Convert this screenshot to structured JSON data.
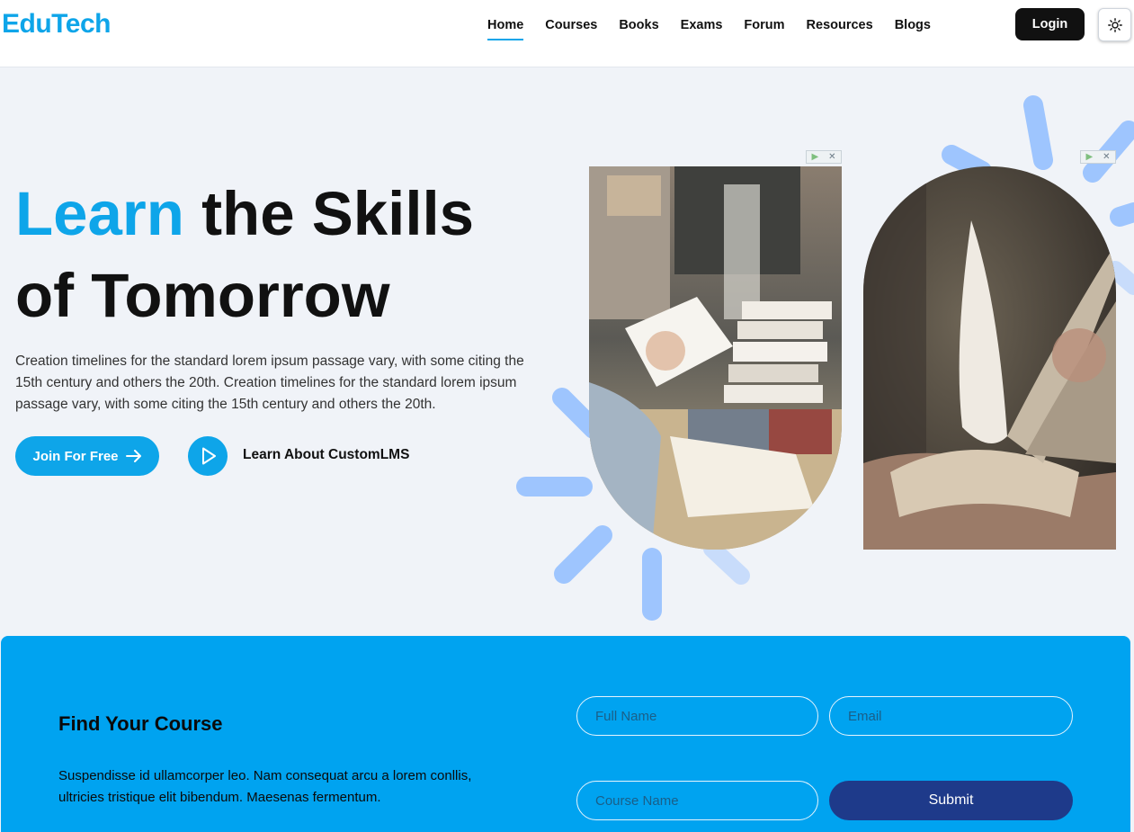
{
  "header": {
    "logo": "EduTech",
    "nav": [
      {
        "label": "Home",
        "active": true
      },
      {
        "label": "Courses",
        "active": false
      },
      {
        "label": "Books",
        "active": false
      },
      {
        "label": "Exams",
        "active": false
      },
      {
        "label": "Forum",
        "active": false
      },
      {
        "label": "Resources",
        "active": false
      },
      {
        "label": "Blogs",
        "active": false
      }
    ],
    "login_label": "Login",
    "theme_icon": "sun-icon"
  },
  "hero": {
    "title_accent": "Learn",
    "title_rest_line1": " the Skills",
    "title_line2": "of Tomorrow",
    "description": "Creation timelines for the standard lorem ipsum passage vary, with some citing the 15th century and others the 20th. Creation timelines for the standard lorem ipsum passage vary, with some citing the 15th century and others the 20th.",
    "join_label": "Join For Free",
    "learn_label": "Learn About CustomLMS"
  },
  "find": {
    "title": "Find Your Course",
    "description": "Suspendisse id ullamcorper leo. Nam consequat arcu a lorem conllis, ultricies tristique elit bibendum. Maesenas fermentum.",
    "full_name_placeholder": "Full Name",
    "email_placeholder": "Email",
    "course_placeholder": "Course Name",
    "submit_label": "Submit"
  },
  "colors": {
    "accent": "#0ea5e9",
    "section_bg": "#00a3f0",
    "submit_bg": "#1e3a8a",
    "ray": "#9ec5fe"
  }
}
